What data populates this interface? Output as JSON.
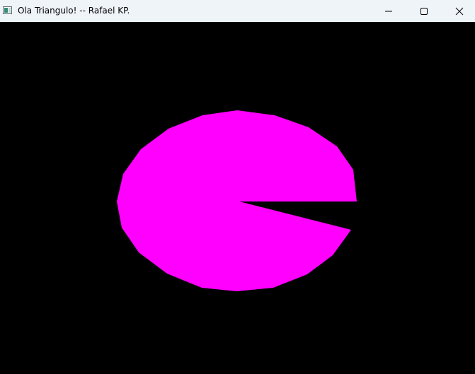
{
  "window": {
    "title": "Ola Triangulo! -- Rafael KP.",
    "titlebar_color": "#eff4f9",
    "icons": {
      "app": "app-window-icon",
      "minimize": "minimize-icon",
      "maximize": "maximize-icon",
      "close": "close-icon"
    }
  },
  "canvas": {
    "background_color": "#000000",
    "shape": {
      "type": "pac-man-polygon",
      "fill_color": "#ff00ff"
    }
  }
}
